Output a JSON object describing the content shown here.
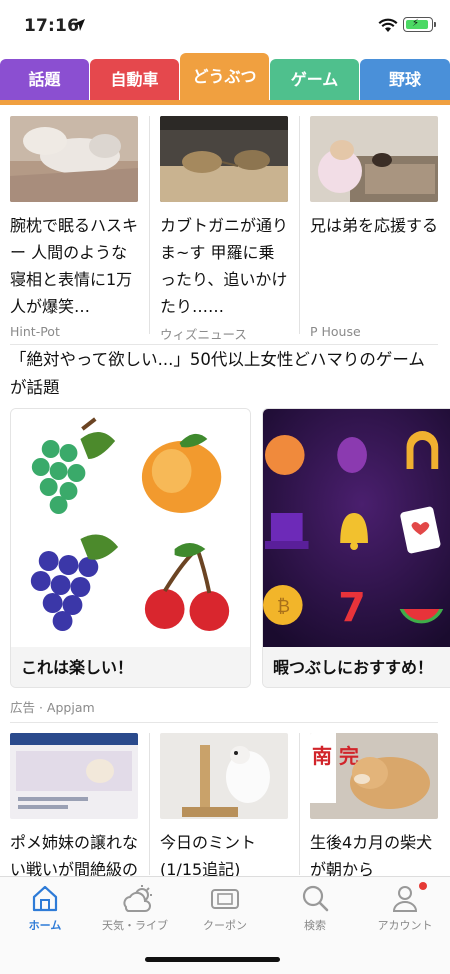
{
  "status_bar": {
    "time": "17:16"
  },
  "tabs": [
    {
      "label": "話題",
      "color": "#8b4fd1"
    },
    {
      "label": "自動車",
      "color": "#e5484d"
    },
    {
      "label": "どうぶつ",
      "color": "#f0a040",
      "active": true
    },
    {
      "label": "ゲーム",
      "color": "#4fc08d"
    },
    {
      "label": "野球",
      "color": "#4a90d9"
    }
  ],
  "articles_top": [
    {
      "title": "腕枕で眠るハスキー 人間のような寝相と表情に1万人が爆笑…",
      "source": "Hint-Pot"
    },
    {
      "title": "カブトガニが通りま~す 甲羅に乗ったり、追いかけたり……",
      "source": "ウィズニュース"
    },
    {
      "title": "兄は弟を応援する",
      "source": "P House"
    }
  ],
  "ad": {
    "headline": "「絶対やって欲しい...」50代以上女性どハマりのゲームが話題",
    "cards": [
      {
        "caption": "これは楽しい！"
      },
      {
        "caption": "暇つぶしにおすすめ！"
      }
    ],
    "source": "広告 · Appjam"
  },
  "articles_bottom": [
    {
      "title": "ポメ姉妹の譲れない戦いが間絶級の",
      "thumb_text": ""
    },
    {
      "title": "今日のミント (1/15追記)",
      "thumb_text": ""
    },
    {
      "title": "生後4カ月の柴犬が朝から",
      "thumb_text": "南 完"
    }
  ],
  "bottom_nav": [
    {
      "label": "ホーム",
      "icon": "home-icon",
      "active": true
    },
    {
      "label": "天気・ライブ",
      "icon": "weather-icon"
    },
    {
      "label": "クーポン",
      "icon": "coupon-icon"
    },
    {
      "label": "検索",
      "icon": "search-icon"
    },
    {
      "label": "アカウント",
      "icon": "account-icon"
    }
  ],
  "colors": {
    "accent": "#f0a040",
    "active_nav": "#2e7bd7",
    "badge": "#e53935"
  }
}
